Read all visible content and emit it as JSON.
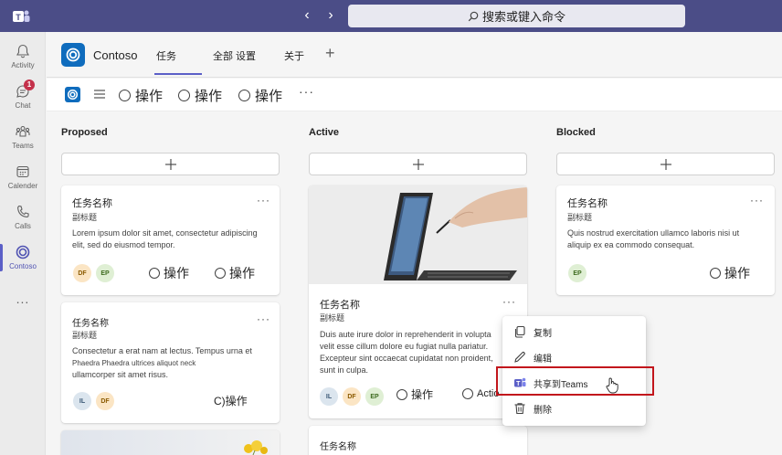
{
  "titlebar": {
    "search_text": "搜索或键入命令"
  },
  "rail": {
    "items": [
      {
        "label": "Activity"
      },
      {
        "label": "Chat",
        "badge": "1"
      },
      {
        "label": "Teams"
      },
      {
        "label": "Calender"
      },
      {
        "label": "Calls"
      },
      {
        "label": "Contoso"
      }
    ],
    "more": "..."
  },
  "apphead": {
    "app_name": "Contoso",
    "tabs": [
      {
        "label": "任务"
      },
      {
        "label": "全部 设置"
      },
      {
        "label": "关于"
      }
    ],
    "add_tab": "+"
  },
  "toolbar": {
    "actions": [
      "操作",
      "操作",
      "操作"
    ],
    "more": "···"
  },
  "columns": [
    {
      "title": "Proposed"
    },
    {
      "title": "Active"
    },
    {
      "title": "Blocked"
    }
  ],
  "cards": {
    "proposed_1": {
      "title": "任务名称",
      "subtitle": "副标题",
      "body": [
        "Lorem ipsum dolor sit amet, consectetur adipiscing",
        "elit, sed do eiusmod tempor."
      ],
      "avatars": [
        "DF",
        "EP"
      ],
      "actions": [
        "操作",
        "操作"
      ]
    },
    "proposed_2": {
      "title": "任务名称",
      "subtitle": "副标题",
      "body": [
        "Consectetur a erat nam at lectus. Tempus urna et",
        "Phaedra Phaedra ultrices aliquot neck",
        "ullamcorper sit amet risus."
      ],
      "avatars": [
        "IL",
        "DF"
      ],
      "action": "C)操作"
    },
    "active_1": {
      "title": "任务名称",
      "subtitle": "副标题",
      "body": [
        "Duis aute irure dolor in reprehenderit in volupta",
        "velit esse cillum dolore eu fugiat nulla pariatur.",
        "Excepteur sint occaecat cupidatat non proident,",
        "sunt in culpa."
      ],
      "avatars": [
        "IL",
        "DF",
        "EP"
      ],
      "actions": [
        "操作",
        "Actio"
      ]
    },
    "active_2": {
      "title": "任务名称"
    },
    "blocked_1": {
      "title": "任务名称",
      "subtitle": "副标题",
      "body": [
        "Quis nostrud exercitation ullamco laboris nisi ut",
        "aliquip ex ea commodo consequat."
      ],
      "avatars": [
        "EP"
      ],
      "action": "操作"
    },
    "more": "···"
  },
  "context_menu": {
    "items": [
      {
        "label": "复制",
        "icon": "copy-icon"
      },
      {
        "label": "编辑",
        "icon": "pencil-icon"
      },
      {
        "label": "共享到Teams",
        "icon": "teams-icon"
      },
      {
        "label": "删除",
        "icon": "trash-icon"
      }
    ]
  },
  "colors": {
    "titlebar": "#4b4d87",
    "accent": "#5b5fc7",
    "highlight": "#c2161c",
    "app_blue": "#0f6cbd"
  }
}
